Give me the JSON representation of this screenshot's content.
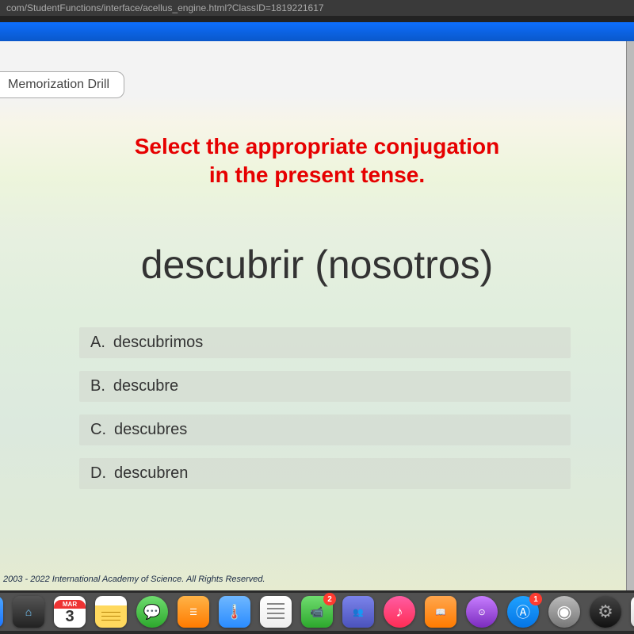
{
  "url": "com/StudentFunctions/interface/acellus_engine.html?ClassID=1819221617",
  "tab": {
    "label": "Memorization Drill"
  },
  "prompt": {
    "line1": "Select the appropriate conjugation",
    "line2": "in the present tense."
  },
  "question": "descubrir (nosotros)",
  "answers": [
    {
      "letter": "A.",
      "text": "descubrimos"
    },
    {
      "letter": "B.",
      "text": "descubre"
    },
    {
      "letter": "C.",
      "text": "descubres"
    },
    {
      "letter": "D.",
      "text": "descubren"
    }
  ],
  "copyright": "2003 - 2022 International Academy of Science. All Rights Reserved.",
  "dock": {
    "calendar": {
      "month": "MAR",
      "day": "3"
    },
    "badges": {
      "facetime": "2",
      "appstore": "1"
    }
  }
}
